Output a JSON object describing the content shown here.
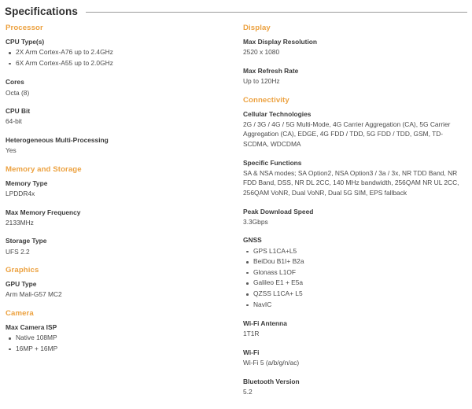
{
  "page": {
    "title": "Specifications"
  },
  "left_column": [
    {
      "heading": "Processor",
      "specs": [
        {
          "label": "CPU Type(s)",
          "items": [
            "2X Arm Cortex-A76 up to 2.4GHz",
            "6X Arm Cortex-A55 up to 2.0GHz"
          ]
        },
        {
          "label": "Cores",
          "value": "Octa (8)"
        },
        {
          "label": "CPU Bit",
          "value": "64-bit"
        },
        {
          "label": "Heterogeneous Multi-Processing",
          "value": "Yes"
        }
      ]
    },
    {
      "heading": "Memory and Storage",
      "specs": [
        {
          "label": "Memory Type",
          "value": "LPDDR4x"
        },
        {
          "label": "Max Memory Frequency",
          "value": "2133MHz"
        },
        {
          "label": "Storage Type",
          "value": "UFS 2.2"
        }
      ]
    },
    {
      "heading": "Graphics",
      "specs": [
        {
          "label": "GPU Type",
          "value": "Arm Mali-G57 MC2"
        }
      ]
    },
    {
      "heading": "Camera",
      "specs": [
        {
          "label": "Max Camera ISP",
          "items": [
            "Native 108MP",
            "16MP + 16MP"
          ]
        }
      ]
    }
  ],
  "right_column": [
    {
      "heading": "Display",
      "specs": [
        {
          "label": "Max Display Resolution",
          "value": "2520 x 1080"
        },
        {
          "label": "Max Refresh Rate",
          "value": "Up to 120Hz"
        }
      ]
    },
    {
      "heading": "Connectivity",
      "specs": [
        {
          "label": "Cellular Technologies",
          "value": "2G / 3G / 4G / 5G Multi-Mode, 4G Carrier Aggregation (CA), 5G Carrier Aggregation (CA), EDGE, 4G FDD / TDD, 5G FDD / TDD, GSM, TD-SCDMA, WDCDMA"
        },
        {
          "label": "Specific Functions",
          "value": "SA & NSA modes; SA Option2, NSA Option3 / 3a / 3x, NR TDD Band, NR FDD Band, DSS, NR DL 2CC, 140 MHz bandwidth, 256QAM NR UL 2CC, 256QAM VoNR, Dual VoNR, Dual 5G SIM, EPS fallback"
        },
        {
          "label": "Peak Download Speed",
          "value": "3.3Gbps"
        },
        {
          "label": "GNSS",
          "items": [
            "GPS L1CA+L5",
            "BeiDou B1I+ B2a",
            "Glonass L1OF",
            "Galileo E1 + E5a",
            "QZSS L1CA+ L5",
            "NavIC"
          ]
        },
        {
          "label": "Wi-Fi Antenna",
          "value": "1T1R"
        },
        {
          "label": "Wi-Fi",
          "value": "Wi-Fi 5 (a/b/g/n/ac)"
        },
        {
          "label": "Bluetooth Version",
          "value": "5.2"
        }
      ]
    }
  ],
  "colors": {
    "section_heading": "#eca13f",
    "label_text": "#3a3a3a",
    "value_text": "#4a4a4a",
    "rule": "#9a9a9a",
    "background": "#ffffff"
  }
}
